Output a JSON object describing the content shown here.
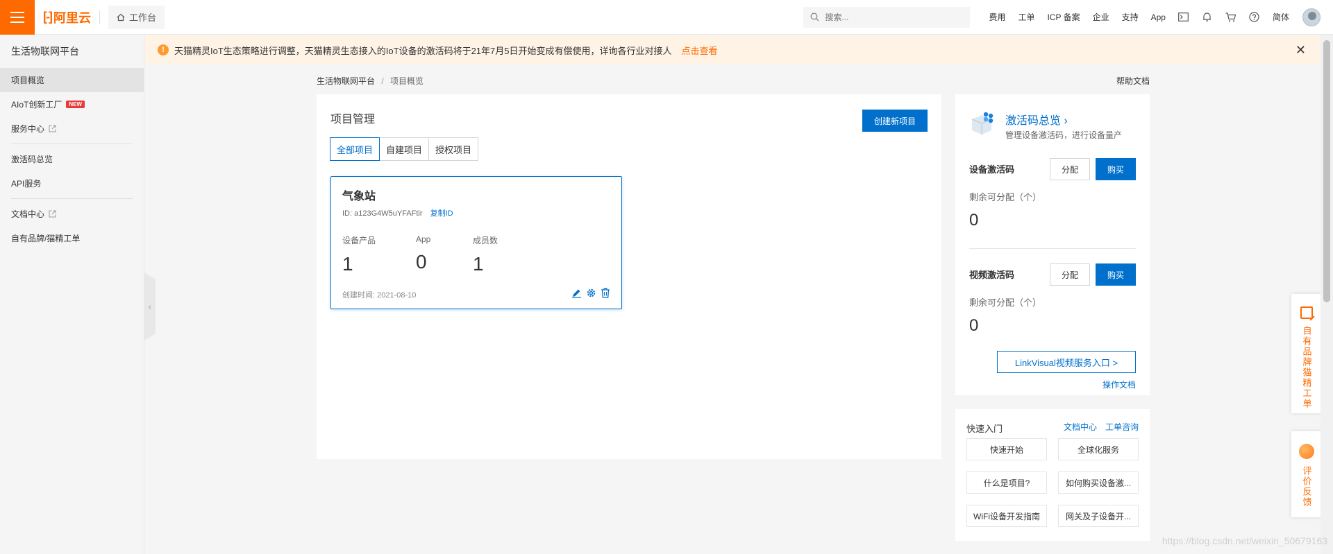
{
  "topbar": {
    "logo_text": "阿里云",
    "logo_mark": "[-]",
    "workbench_label": "工作台",
    "search_placeholder": "搜索...",
    "links": [
      "费用",
      "工单",
      "ICP 备案",
      "企业",
      "支持",
      "App"
    ],
    "lang_label": "简体"
  },
  "sidebar": {
    "title": "生活物联网平台",
    "items": [
      {
        "label": "项目概览"
      },
      {
        "label": "AIoT创新工厂",
        "badge": "NEW"
      },
      {
        "label": "服务中心"
      },
      {
        "label": "激活码总览"
      },
      {
        "label": "API服务"
      },
      {
        "label": "文档中心"
      },
      {
        "label": "自有品牌/猫精工单"
      }
    ]
  },
  "notice": {
    "icon": "!",
    "text": "天猫精灵IoT生态策略进行调整，天猫精灵生态接入的IoT设备的激活码将于21年7月5日开始变成有偿使用，详询各行业对接人",
    "link": "点击查看"
  },
  "breadcrumb": {
    "root": "生活物联网平台",
    "sep": "/",
    "current": "项目概览",
    "help": "帮助文档"
  },
  "main": {
    "title": "项目管理",
    "create_button": "创建新项目",
    "tabs": [
      {
        "label": "全部项目"
      },
      {
        "label": "自建项目"
      },
      {
        "label": "授权项目"
      }
    ],
    "project": {
      "name": "气象站",
      "id_label": "ID: a123G4W5uYFAFtir",
      "copy_label": "复制ID",
      "stats": [
        {
          "label": "设备产品",
          "value": "1"
        },
        {
          "label": "App",
          "value": "0"
        },
        {
          "label": "成员数",
          "value": "1"
        }
      ],
      "created": "创建时间: 2021-08-10"
    }
  },
  "activation": {
    "title": "激活码总览",
    "title_arrow": "›",
    "subtitle": "管理设备激活码，进行设备量产",
    "device": {
      "title": "设备激活码",
      "assign": "分配",
      "buy": "购买",
      "remain_label": "剩余可分配（个）",
      "remain_value": "0"
    },
    "video": {
      "title": "视频激活码",
      "assign": "分配",
      "buy": "购买",
      "remain_label": "剩余可分配（个）",
      "remain_value": "0"
    },
    "linkvisual": "LinkVisual视频服务入口  >",
    "op_doc": "操作文档"
  },
  "quick": {
    "title": "快速入门",
    "link_doc": "文档中心",
    "link_ticket": "工单咨询",
    "buttons": [
      "快速开始",
      "全球化服务",
      "什么是项目?",
      "如何购买设备激...",
      "WiFi设备开发指南",
      "网关及子设备开..."
    ]
  },
  "float": {
    "brand": "自有品牌猫精工单",
    "feedback": "评价反馈"
  },
  "watermark": "https://blog.csdn.net/weixin_50679163",
  "colors": {
    "brand": "#ff6a00",
    "primary": "#0070cc",
    "notice_bg": "#fff3e6"
  }
}
